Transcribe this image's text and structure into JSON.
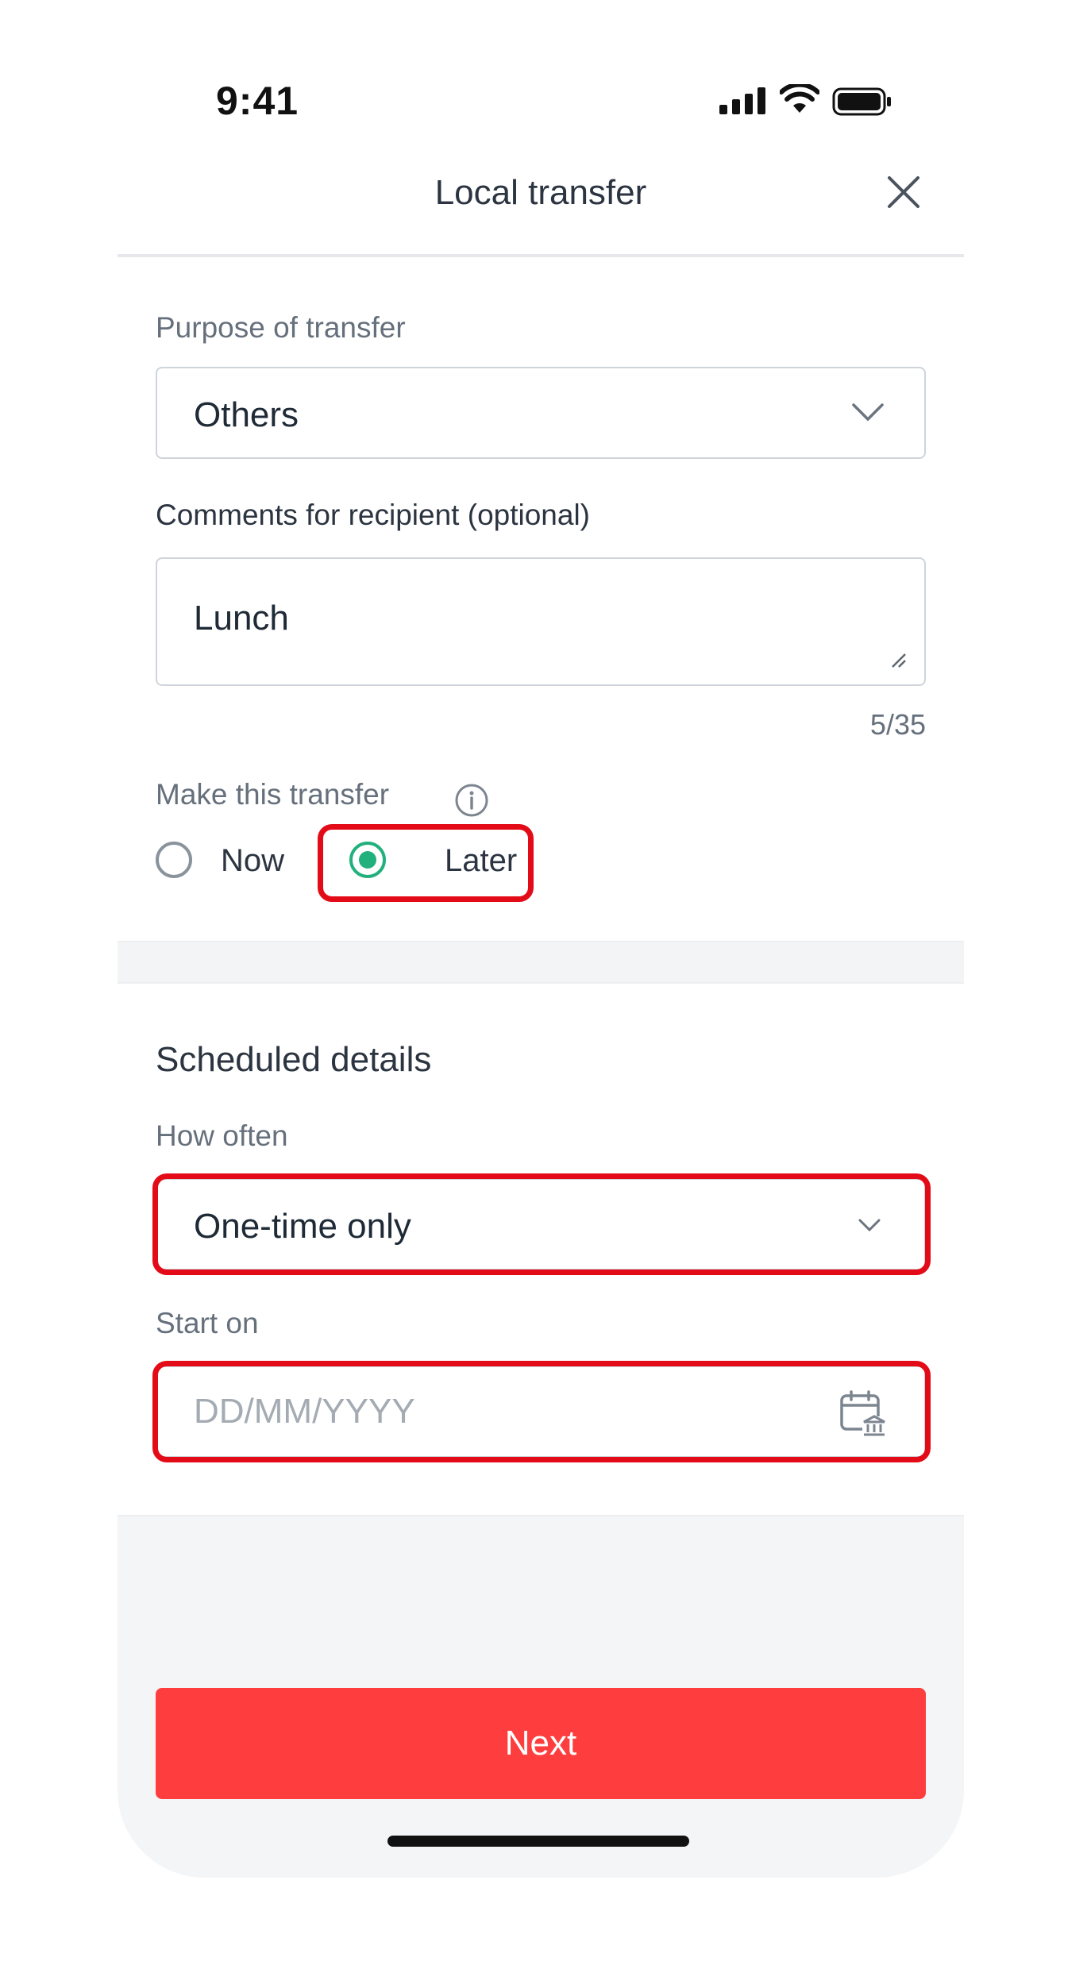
{
  "status_bar": {
    "time": "9:41"
  },
  "header": {
    "title": "Local transfer"
  },
  "purpose": {
    "label": "Purpose of transfer",
    "value": "Others"
  },
  "comments": {
    "label": "Comments for recipient (optional)",
    "value": "Lunch",
    "counter": "5/35"
  },
  "timing": {
    "label": "Make this transfer",
    "options": [
      {
        "label": "Now",
        "selected": false
      },
      {
        "label": "Later",
        "selected": true
      }
    ]
  },
  "schedule": {
    "title": "Scheduled details",
    "frequency_label": "How often",
    "frequency_value": "One-time only",
    "start_label": "Start on",
    "start_placeholder": "DD/MM/YYYY"
  },
  "footer": {
    "next_label": "Next"
  },
  "colors": {
    "accent_green": "#22b07d",
    "primary_red": "#fe3e3e",
    "highlight_red": "#e30b17"
  }
}
